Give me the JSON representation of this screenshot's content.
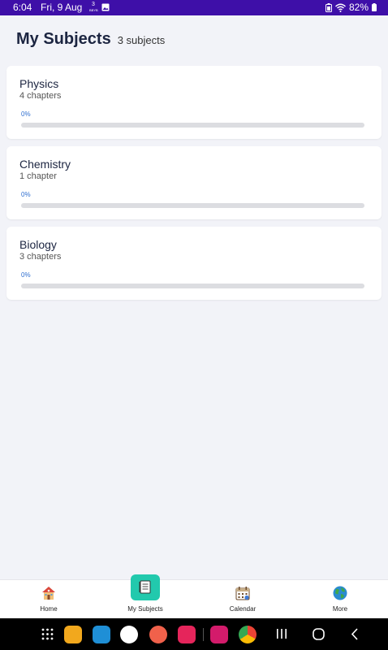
{
  "status_bar": {
    "time": "6:04",
    "date": "Fri, 9 Aug",
    "notification_count": "3",
    "notification_sub": "BBYB",
    "battery": "82%"
  },
  "header": {
    "title": "My Subjects",
    "count_label": "3 subjects"
  },
  "subjects": [
    {
      "name": "Physics",
      "chapters": "4 chapters",
      "progress_label": "0%",
      "progress": 0
    },
    {
      "name": "Chemistry",
      "chapters": "1 chapter",
      "progress_label": "0%",
      "progress": 0
    },
    {
      "name": "Biology",
      "chapters": "3 chapters",
      "progress_label": "0%",
      "progress": 0
    }
  ],
  "bottom_nav": {
    "items": [
      {
        "label": "Home",
        "icon": "school-icon"
      },
      {
        "label": "My Subjects",
        "icon": "notebook-icon",
        "active": true
      },
      {
        "label": "Calendar",
        "icon": "calendar-icon"
      },
      {
        "label": "More",
        "icon": "globe-icon"
      }
    ]
  },
  "colors": {
    "status_bar": "#3e0fa8",
    "accent": "#22c9ad",
    "progress_pct": "#2f6fd0",
    "title": "#1c2541"
  }
}
